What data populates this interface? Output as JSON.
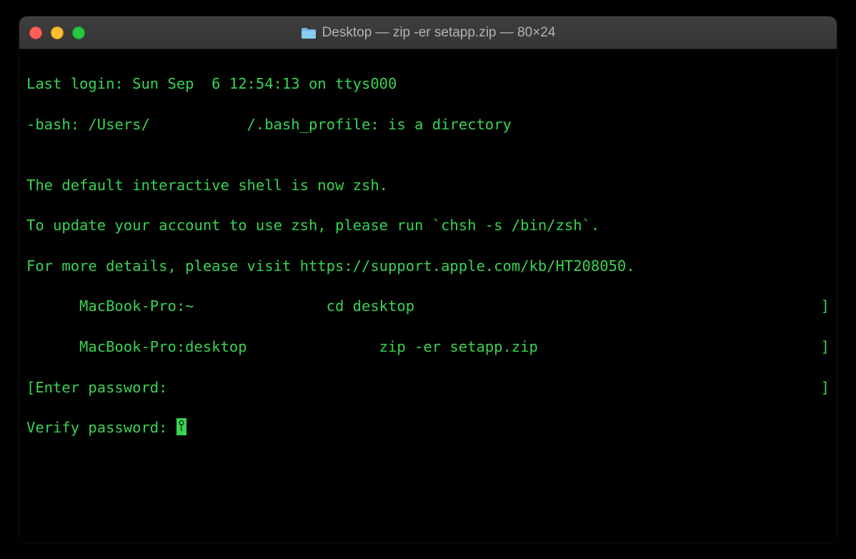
{
  "window": {
    "title": "Desktop — zip -er setapp.zip — 80×24"
  },
  "terminal": {
    "lines": {
      "l0": "Last login: Sun Sep  6 12:54:13 on ttys000",
      "l1": "-bash: /Users/           /.bash_profile: is a directory",
      "l2": "",
      "l3": "The default interactive shell is now zsh.",
      "l4": "To update your account to use zsh, please run `chsh -s /bin/zsh`.",
      "l5": "For more details, please visit https://support.apple.com/kb/HT208050.",
      "l6": "      MacBook-Pro:~               cd desktop",
      "l7": "      MacBook-Pro:desktop               zip -er setapp.zip",
      "l8": "[Enter password:",
      "l9": "Verify password: ",
      "rb": "]"
    }
  }
}
